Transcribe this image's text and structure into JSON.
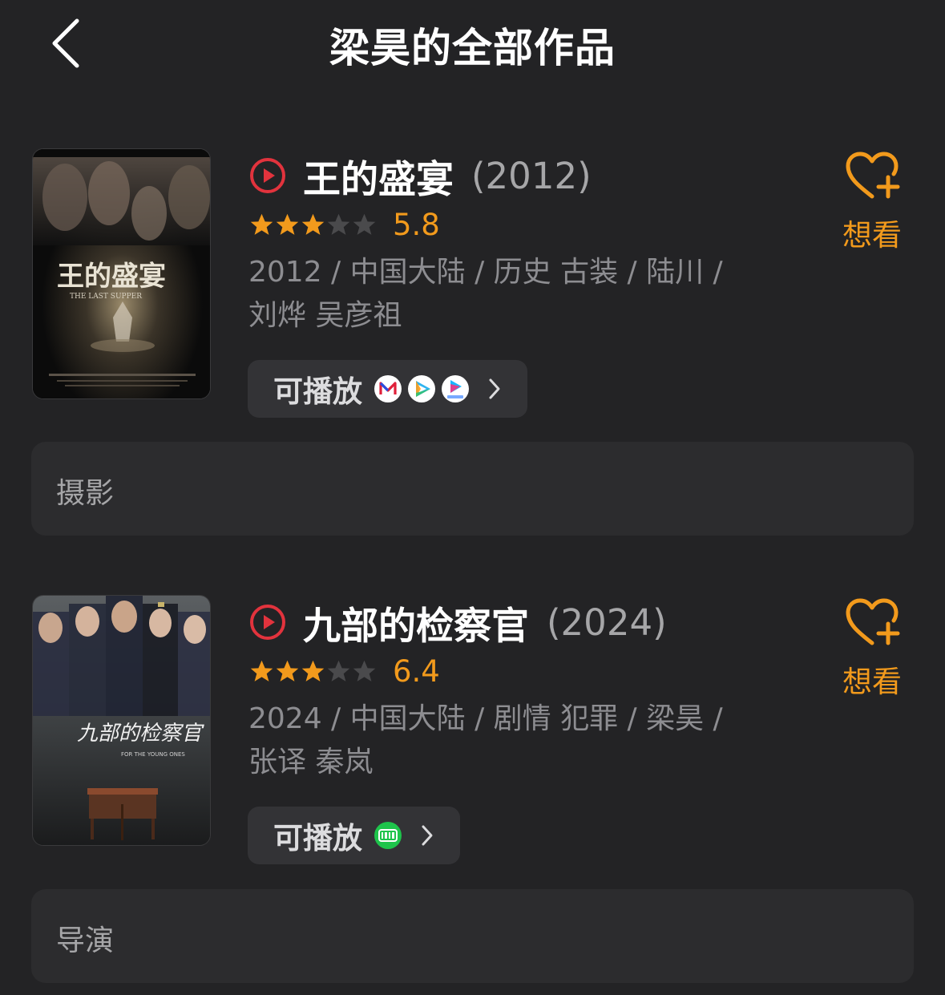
{
  "header": {
    "back_icon": "chevron-left-icon",
    "title": "梁昊的全部作品"
  },
  "colors": {
    "background": "#232325",
    "accent_orange": "#f29a1c",
    "play_red": "#e2333d",
    "muted_text": "#8d8d91"
  },
  "works": [
    {
      "title": "王的盛宴",
      "year": "(2012)",
      "rating": "5.8",
      "stars": 3,
      "meta_line1": "2012 / 中国大陆 / 历史 古装 / 陆川 /",
      "meta_line2": "刘烨 吴彦祖",
      "playable_label": "可播放",
      "platforms": [
        "mgtv-icon",
        "tencent-video-icon",
        "youku-icon"
      ],
      "want_label": "想看",
      "role": "摄影",
      "poster": {
        "title_art": "王的盛宴",
        "subtitle_art": "THE LAST SUPPER"
      }
    },
    {
      "title": "九部的检察官",
      "year": "(2024)",
      "rating": "6.4",
      "stars": 3,
      "meta_line1": "2024 / 中国大陆 / 剧情 犯罪 / 梁昊 /",
      "meta_line2": "张译 秦岚",
      "playable_label": "可播放",
      "platforms": [
        "iqiyi-icon"
      ],
      "want_label": "想看",
      "role": "导演",
      "poster": {
        "title_art": "九部的检察官",
        "subtitle_art": "FOR THE YOUNG ONES"
      }
    }
  ]
}
